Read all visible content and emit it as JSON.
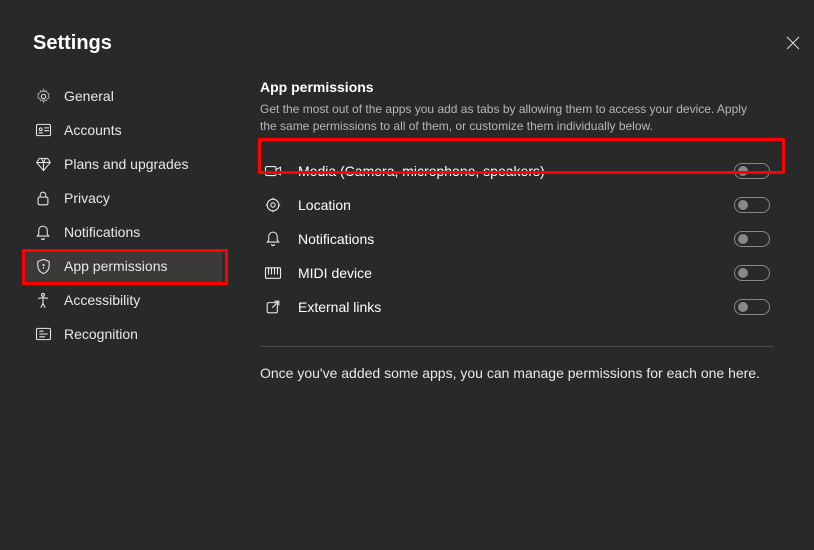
{
  "header": {
    "title": "Settings"
  },
  "sidebar": {
    "items": [
      {
        "label": "General",
        "icon": "gear-icon"
      },
      {
        "label": "Accounts",
        "icon": "id-card-icon"
      },
      {
        "label": "Plans and upgrades",
        "icon": "diamond-icon"
      },
      {
        "label": "Privacy",
        "icon": "lock-icon"
      },
      {
        "label": "Notifications",
        "icon": "bell-icon"
      },
      {
        "label": "App permissions",
        "icon": "shield-icon",
        "active": true
      },
      {
        "label": "Accessibility",
        "icon": "accessibility-icon"
      },
      {
        "label": "Recognition",
        "icon": "recognition-icon"
      }
    ]
  },
  "content": {
    "section_title": "App permissions",
    "section_desc": "Get the most out of the apps you add as tabs by allowing them to access your device. Apply the same permissions to all of them, or customize them individually below.",
    "permissions": [
      {
        "label": "Media (Camera, microphone, speakers)",
        "icon": "camera-icon",
        "on": false
      },
      {
        "label": "Location",
        "icon": "location-icon",
        "on": false
      },
      {
        "label": "Notifications",
        "icon": "bell-icon",
        "on": false
      },
      {
        "label": "MIDI device",
        "icon": "midi-icon",
        "on": false
      },
      {
        "label": "External links",
        "icon": "external-link-icon",
        "on": false
      }
    ],
    "footer_text": "Once you've added some apps, you can manage permissions for each one here."
  },
  "highlights": {
    "sidebar_color": "#ff0000",
    "media_color": "#ff0000"
  }
}
